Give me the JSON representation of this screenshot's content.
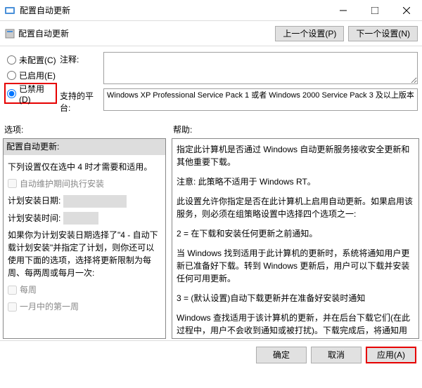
{
  "window": {
    "title": "配置自动更新"
  },
  "subheader": {
    "icon_label": "配置自动更新",
    "prev": "上一个设置(P)",
    "next": "下一个设置(N)"
  },
  "radios": {
    "not_configured": "未配置(C)",
    "enabled": "已启用(E)",
    "disabled": "已禁用(D)"
  },
  "right": {
    "comment_label": "注释:",
    "platform_label": "支持的平台:",
    "platform_text": "Windows XP Professional Service Pack 1 或者 Windows 2000 Service Pack 3 及以上版本"
  },
  "lower_headers": {
    "options": "选项:",
    "help": "帮助:"
  },
  "options": {
    "title": "配置自动更新:",
    "text1": "下列设置仅在选中 4 时才需要和适用。",
    "check1": "自动维护期间执行安装",
    "row1": "计划安装日期:",
    "row2": "计划安装时间:",
    "text2": "如果你为计划安装日期选择了\"4 - 自动下载计划安装\"并指定了计划，则你还可以使用下面的选项，选择将更新限制为每周、每两周或每月一次:",
    "check2": "每周",
    "check3": "一月中的第一周"
  },
  "help": {
    "p1": "指定此计算机是否通过 Windows 自动更新服务接收安全更新和其他重要下载。",
    "p2": "注意: 此策略不适用于 Windows RT。",
    "p3": "此设置允许你指定是否在此计算机上启用自动更新。如果启用该服务，则必须在组策略设置中选择四个选项之一:",
    "p4": "2 = 在下载和安装任何更新之前通知。",
    "p5": "当 Windows 找到适用于此计算机的更新时，系统将通知用户更新已准备好下载。转到 Windows 更新后，用户可以下载并安装任何可用更新。",
    "p6": "3 = (默认设置)自动下载更新并在准备好安装时通知",
    "p7": "Windows 查找适用于该计算机的更新，并在后台下载它们(在此过程中，用户不会收到通知或被打扰)。下载完成后，将通知用户更新已准备好进行安装。在转到 Windows 更新后，用户可以安装它们。"
  },
  "footer": {
    "ok": "确定",
    "cancel": "取消",
    "apply": "应用(A)"
  }
}
